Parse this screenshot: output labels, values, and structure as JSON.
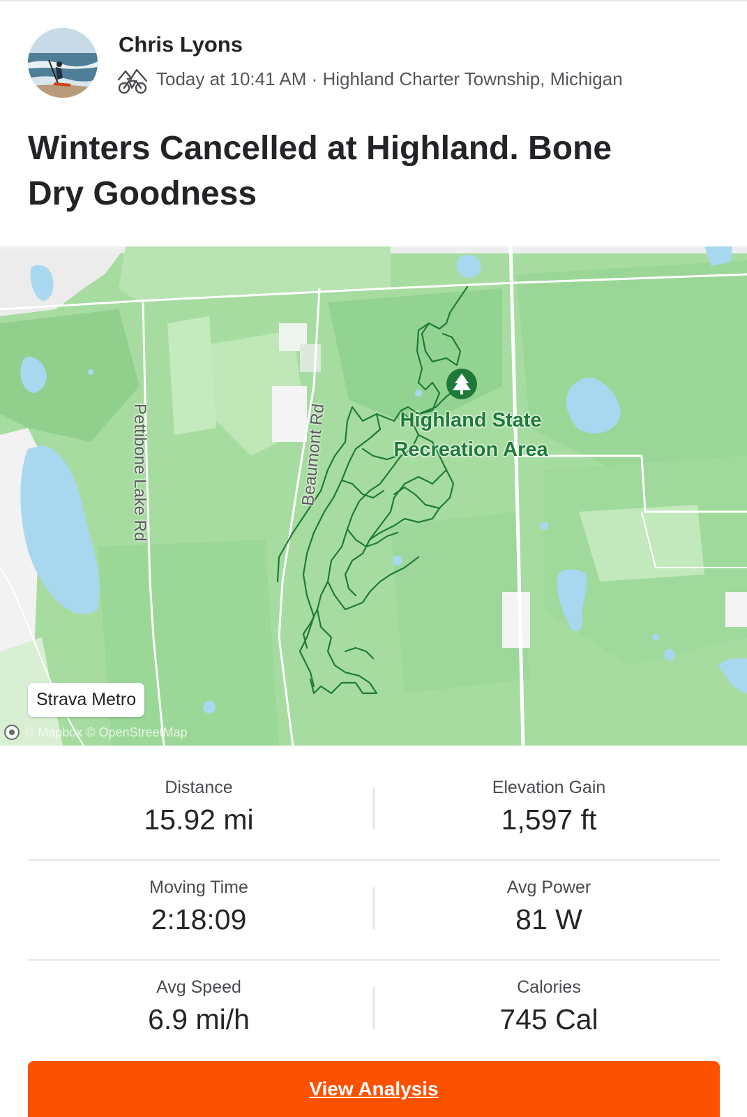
{
  "colors": {
    "brand_orange": "#fc5200",
    "map_green": "#a6dca0",
    "route_green": "#1f7a3a",
    "water_blue": "#a8d8f0"
  },
  "header": {
    "athlete_name": "Chris Lyons",
    "activity_icon": "bike-icon",
    "meta": "Today at 10:41 AM · Highland Charter Township, Michigan"
  },
  "activity": {
    "title": "Winters Cancelled at Highland. Bone Dry Goodness"
  },
  "map": {
    "road_labels": [
      "Pettibone Lake Rd",
      "Beaumont Rd"
    ],
    "park_label_line1": "Highland State",
    "park_label_line2": "Recreation Area",
    "park_icon": "tree-icon",
    "metro_badge": "Strava Metro",
    "attribution": "© Mapbox © OpenStreetMap"
  },
  "stats": [
    {
      "label": "Distance",
      "value": "15.92 mi"
    },
    {
      "label": "Elevation Gain",
      "value": "1,597 ft"
    },
    {
      "label": "Moving Time",
      "value": "2:18:09"
    },
    {
      "label": "Avg Power",
      "value": "81 W"
    },
    {
      "label": "Avg Speed",
      "value": "6.9 mi/h"
    },
    {
      "label": "Calories",
      "value": "745 Cal"
    }
  ],
  "actions": {
    "view_analysis": "View Analysis"
  }
}
